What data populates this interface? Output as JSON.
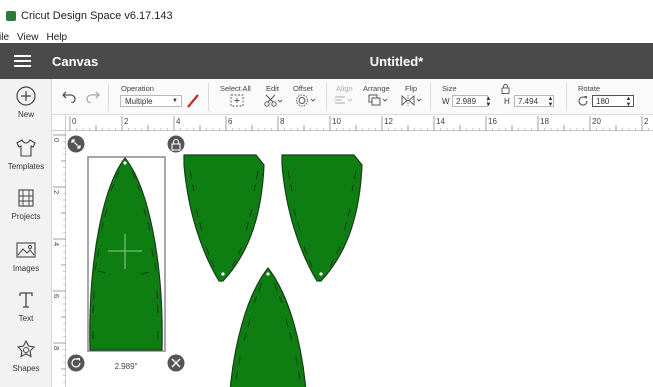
{
  "app": {
    "title": "Cricut Design Space  v6.17.143"
  },
  "menu": {
    "file": "ile",
    "view": "View",
    "help": "Help"
  },
  "header": {
    "canvas_label": "Canvas",
    "doc_title": "Untitled*"
  },
  "sidebar": {
    "items": [
      {
        "label": "New",
        "icon": "plus-circle-icon"
      },
      {
        "label": "Templates",
        "icon": "shirt-icon"
      },
      {
        "label": "Projects",
        "icon": "projects-icon"
      },
      {
        "label": "Images",
        "icon": "image-icon"
      },
      {
        "label": "Text",
        "icon": "text-icon"
      },
      {
        "label": "Shapes",
        "icon": "shapes-icon"
      }
    ]
  },
  "toolbar": {
    "operation_label": "Operation",
    "operation_value": "Multiple",
    "select_all_label": "Select All",
    "edit_label": "Edit",
    "offset_label": "Offset",
    "align_label": "Align",
    "arrange_label": "Arrange",
    "flip_label": "Flip",
    "size_label": "Size",
    "w_label": "W",
    "w_value": "2.989",
    "h_label": "H",
    "h_value": "7.494",
    "rotate_label": "Rotate",
    "rotate_value": "180"
  },
  "ruler": {
    "h_ticks": [
      "0",
      "2",
      "4",
      "6",
      "8",
      "10",
      "12",
      "14",
      "16",
      "18",
      "20",
      "2"
    ],
    "v_ticks": [
      "0",
      "2",
      "4",
      "6",
      "8"
    ]
  },
  "selection": {
    "width_readout": "2.989\""
  },
  "colors": {
    "shape_fill": "#0e7d12",
    "shape_stroke": "#1b3d1b",
    "header_bg": "#4a4a4b",
    "pen_red": "#c62828"
  }
}
